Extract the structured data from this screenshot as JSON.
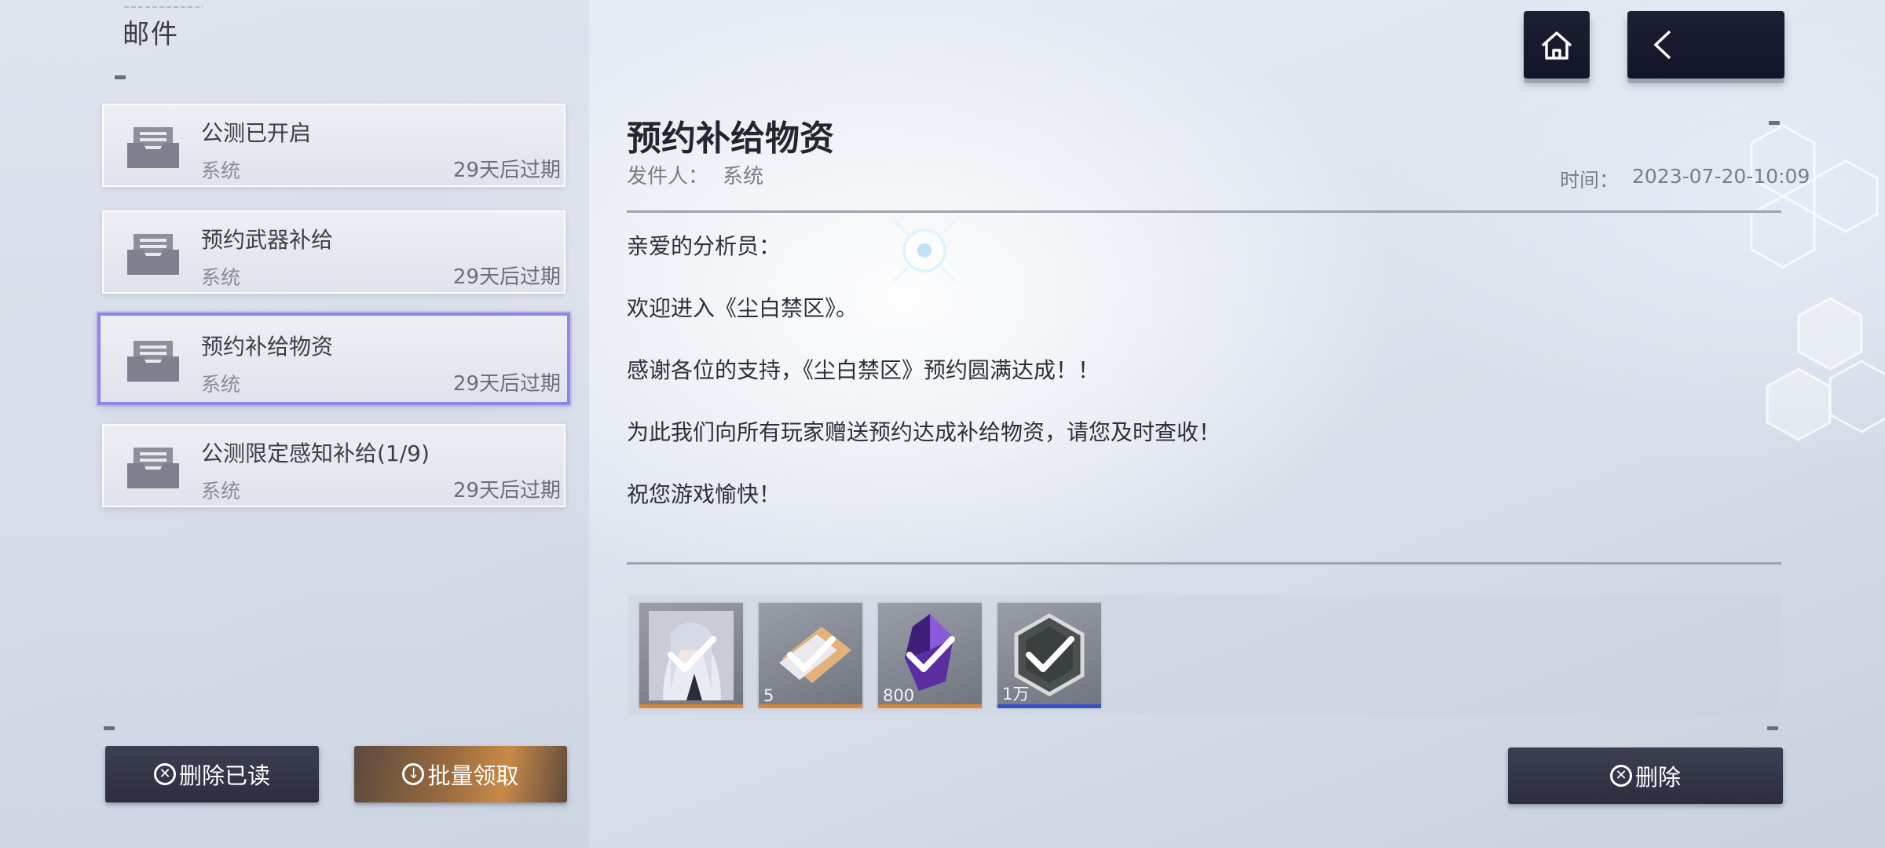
{
  "page": {
    "title": "邮件"
  },
  "mail_list": [
    {
      "subject": "公测已开启",
      "sender": "系统",
      "expire": "29天后过期",
      "selected": false
    },
    {
      "subject": "预约武器补给",
      "sender": "系统",
      "expire": "29天后过期",
      "selected": false
    },
    {
      "subject": "预约补给物资",
      "sender": "系统",
      "expire": "29天后过期",
      "selected": true
    },
    {
      "subject": "公测限定感知补给(1/9)",
      "sender": "系统",
      "expire": "29天后过期",
      "selected": false
    }
  ],
  "buttons": {
    "delete_read": "删除已读",
    "batch_claim": "批量领取",
    "delete": "删除"
  },
  "detail": {
    "title": "预约补给物资",
    "sender_label": "发件人：",
    "sender": "系统",
    "time_label": "时间：",
    "time": "2023-07-20-10:09",
    "body": [
      "亲爱的分析员：",
      "欢迎进入《尘白禁区》。",
      "感谢各位的支持，《尘白禁区》预约圆满达成！！",
      "为此我们向所有玩家赠送预约达成补给物资，请您及时查收！",
      "祝您游戏愉快！"
    ]
  },
  "rewards": [
    {
      "icon": "character-portrait-icon",
      "count": "",
      "claimed": true,
      "rarity_color": "#d8873a"
    },
    {
      "icon": "supply-ticket-icon",
      "count": "5",
      "claimed": true,
      "rarity_color": "#d8873a"
    },
    {
      "icon": "purple-crystal-icon",
      "count": "800",
      "claimed": true,
      "rarity_color": "#d8873a"
    },
    {
      "icon": "hexagon-coin-icon",
      "count": "1万",
      "claimed": true,
      "rarity_color": "#3550c8"
    }
  ],
  "colors": {
    "selected_border": "#8f86e6",
    "button_dark": "#2f3144",
    "button_orange": "#b97a42"
  }
}
